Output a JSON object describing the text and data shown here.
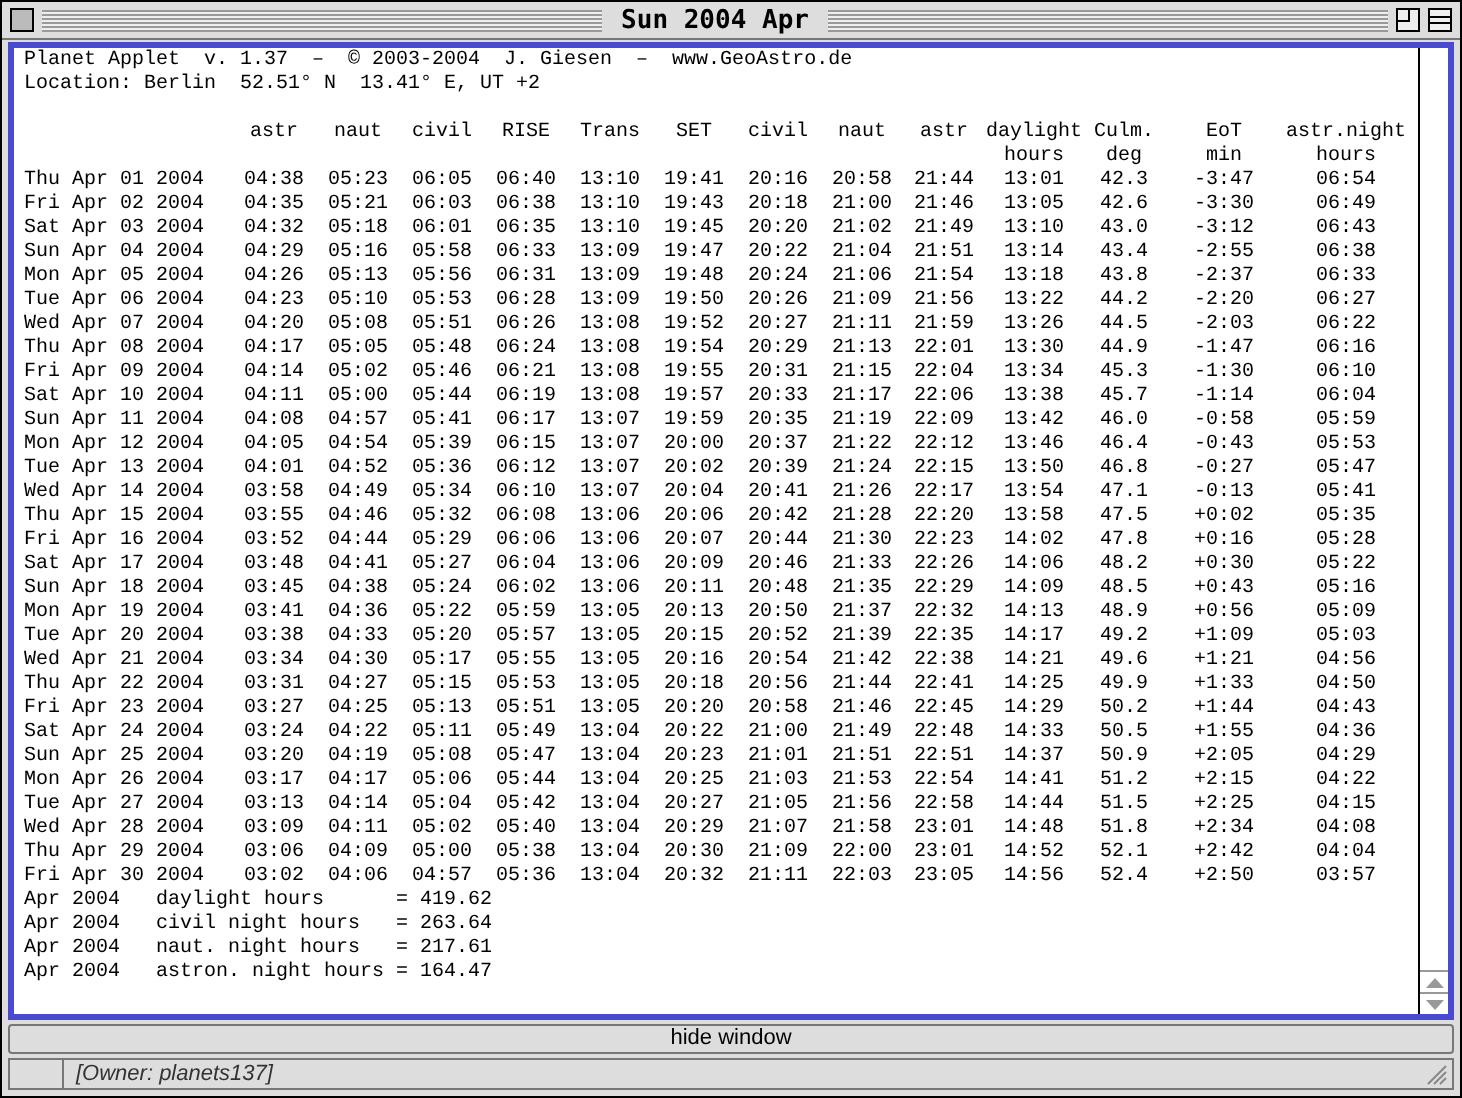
{
  "window": {
    "title": "Sun 2004 Apr"
  },
  "header_lines": [
    "Planet Applet  v. 1.37  –  © 2003-2004  J. Giesen  –  www.GeoAstro.de",
    "Location: Berlin  52.51° N  13.41° E, UT +2"
  ],
  "table": {
    "columns": [
      "astr",
      "naut",
      "civil",
      "RISE",
      "Trans",
      "SET",
      "civil",
      "naut",
      "astr",
      "daylight\nhours",
      "Culm.\ndeg",
      "EoT\nmin",
      "astr.night\nhours"
    ],
    "rows": [
      {
        "date": "Thu Apr 01 2004",
        "cells": [
          "04:38",
          "05:23",
          "06:05",
          "06:40",
          "13:10",
          "19:41",
          "20:16",
          "20:58",
          "21:44",
          "13:01",
          "42.3",
          "-3:47",
          "06:54"
        ]
      },
      {
        "date": "Fri Apr 02 2004",
        "cells": [
          "04:35",
          "05:21",
          "06:03",
          "06:38",
          "13:10",
          "19:43",
          "20:18",
          "21:00",
          "21:46",
          "13:05",
          "42.6",
          "-3:30",
          "06:49"
        ]
      },
      {
        "date": "Sat Apr 03 2004",
        "cells": [
          "04:32",
          "05:18",
          "06:01",
          "06:35",
          "13:10",
          "19:45",
          "20:20",
          "21:02",
          "21:49",
          "13:10",
          "43.0",
          "-3:12",
          "06:43"
        ]
      },
      {
        "date": "Sun Apr 04 2004",
        "cells": [
          "04:29",
          "05:16",
          "05:58",
          "06:33",
          "13:09",
          "19:47",
          "20:22",
          "21:04",
          "21:51",
          "13:14",
          "43.4",
          "-2:55",
          "06:38"
        ]
      },
      {
        "date": "Mon Apr 05 2004",
        "cells": [
          "04:26",
          "05:13",
          "05:56",
          "06:31",
          "13:09",
          "19:48",
          "20:24",
          "21:06",
          "21:54",
          "13:18",
          "43.8",
          "-2:37",
          "06:33"
        ]
      },
      {
        "date": "Tue Apr 06 2004",
        "cells": [
          "04:23",
          "05:10",
          "05:53",
          "06:28",
          "13:09",
          "19:50",
          "20:26",
          "21:09",
          "21:56",
          "13:22",
          "44.2",
          "-2:20",
          "06:27"
        ]
      },
      {
        "date": "Wed Apr 07 2004",
        "cells": [
          "04:20",
          "05:08",
          "05:51",
          "06:26",
          "13:08",
          "19:52",
          "20:27",
          "21:11",
          "21:59",
          "13:26",
          "44.5",
          "-2:03",
          "06:22"
        ]
      },
      {
        "date": "Thu Apr 08 2004",
        "cells": [
          "04:17",
          "05:05",
          "05:48",
          "06:24",
          "13:08",
          "19:54",
          "20:29",
          "21:13",
          "22:01",
          "13:30",
          "44.9",
          "-1:47",
          "06:16"
        ]
      },
      {
        "date": "Fri Apr 09 2004",
        "cells": [
          "04:14",
          "05:02",
          "05:46",
          "06:21",
          "13:08",
          "19:55",
          "20:31",
          "21:15",
          "22:04",
          "13:34",
          "45.3",
          "-1:30",
          "06:10"
        ]
      },
      {
        "date": "Sat Apr 10 2004",
        "cells": [
          "04:11",
          "05:00",
          "05:44",
          "06:19",
          "13:08",
          "19:57",
          "20:33",
          "21:17",
          "22:06",
          "13:38",
          "45.7",
          "-1:14",
          "06:04"
        ]
      },
      {
        "date": "Sun Apr 11 2004",
        "cells": [
          "04:08",
          "04:57",
          "05:41",
          "06:17",
          "13:07",
          "19:59",
          "20:35",
          "21:19",
          "22:09",
          "13:42",
          "46.0",
          "-0:58",
          "05:59"
        ]
      },
      {
        "date": "Mon Apr 12 2004",
        "cells": [
          "04:05",
          "04:54",
          "05:39",
          "06:15",
          "13:07",
          "20:00",
          "20:37",
          "21:22",
          "22:12",
          "13:46",
          "46.4",
          "-0:43",
          "05:53"
        ]
      },
      {
        "date": "Tue Apr 13 2004",
        "cells": [
          "04:01",
          "04:52",
          "05:36",
          "06:12",
          "13:07",
          "20:02",
          "20:39",
          "21:24",
          "22:15",
          "13:50",
          "46.8",
          "-0:27",
          "05:47"
        ]
      },
      {
        "date": "Wed Apr 14 2004",
        "cells": [
          "03:58",
          "04:49",
          "05:34",
          "06:10",
          "13:07",
          "20:04",
          "20:41",
          "21:26",
          "22:17",
          "13:54",
          "47.1",
          "-0:13",
          "05:41"
        ]
      },
      {
        "date": "Thu Apr 15 2004",
        "cells": [
          "03:55",
          "04:46",
          "05:32",
          "06:08",
          "13:06",
          "20:06",
          "20:42",
          "21:28",
          "22:20",
          "13:58",
          "47.5",
          "+0:02",
          "05:35"
        ]
      },
      {
        "date": "Fri Apr 16 2004",
        "cells": [
          "03:52",
          "04:44",
          "05:29",
          "06:06",
          "13:06",
          "20:07",
          "20:44",
          "21:30",
          "22:23",
          "14:02",
          "47.8",
          "+0:16",
          "05:28"
        ]
      },
      {
        "date": "Sat Apr 17 2004",
        "cells": [
          "03:48",
          "04:41",
          "05:27",
          "06:04",
          "13:06",
          "20:09",
          "20:46",
          "21:33",
          "22:26",
          "14:06",
          "48.2",
          "+0:30",
          "05:22"
        ]
      },
      {
        "date": "Sun Apr 18 2004",
        "cells": [
          "03:45",
          "04:38",
          "05:24",
          "06:02",
          "13:06",
          "20:11",
          "20:48",
          "21:35",
          "22:29",
          "14:09",
          "48.5",
          "+0:43",
          "05:16"
        ]
      },
      {
        "date": "Mon Apr 19 2004",
        "cells": [
          "03:41",
          "04:36",
          "05:22",
          "05:59",
          "13:05",
          "20:13",
          "20:50",
          "21:37",
          "22:32",
          "14:13",
          "48.9",
          "+0:56",
          "05:09"
        ]
      },
      {
        "date": "Tue Apr 20 2004",
        "cells": [
          "03:38",
          "04:33",
          "05:20",
          "05:57",
          "13:05",
          "20:15",
          "20:52",
          "21:39",
          "22:35",
          "14:17",
          "49.2",
          "+1:09",
          "05:03"
        ]
      },
      {
        "date": "Wed Apr 21 2004",
        "cells": [
          "03:34",
          "04:30",
          "05:17",
          "05:55",
          "13:05",
          "20:16",
          "20:54",
          "21:42",
          "22:38",
          "14:21",
          "49.6",
          "+1:21",
          "04:56"
        ]
      },
      {
        "date": "Thu Apr 22 2004",
        "cells": [
          "03:31",
          "04:27",
          "05:15",
          "05:53",
          "13:05",
          "20:18",
          "20:56",
          "21:44",
          "22:41",
          "14:25",
          "49.9",
          "+1:33",
          "04:50"
        ]
      },
      {
        "date": "Fri Apr 23 2004",
        "cells": [
          "03:27",
          "04:25",
          "05:13",
          "05:51",
          "13:05",
          "20:20",
          "20:58",
          "21:46",
          "22:45",
          "14:29",
          "50.2",
          "+1:44",
          "04:43"
        ]
      },
      {
        "date": "Sat Apr 24 2004",
        "cells": [
          "03:24",
          "04:22",
          "05:11",
          "05:49",
          "13:04",
          "20:22",
          "21:00",
          "21:49",
          "22:48",
          "14:33",
          "50.5",
          "+1:55",
          "04:36"
        ]
      },
      {
        "date": "Sun Apr 25 2004",
        "cells": [
          "03:20",
          "04:19",
          "05:08",
          "05:47",
          "13:04",
          "20:23",
          "21:01",
          "21:51",
          "22:51",
          "14:37",
          "50.9",
          "+2:05",
          "04:29"
        ]
      },
      {
        "date": "Mon Apr 26 2004",
        "cells": [
          "03:17",
          "04:17",
          "05:06",
          "05:44",
          "13:04",
          "20:25",
          "21:03",
          "21:53",
          "22:54",
          "14:41",
          "51.2",
          "+2:15",
          "04:22"
        ]
      },
      {
        "date": "Tue Apr 27 2004",
        "cells": [
          "03:13",
          "04:14",
          "05:04",
          "05:42",
          "13:04",
          "20:27",
          "21:05",
          "21:56",
          "22:58",
          "14:44",
          "51.5",
          "+2:25",
          "04:15"
        ]
      },
      {
        "date": "Wed Apr 28 2004",
        "cells": [
          "03:09",
          "04:11",
          "05:02",
          "05:40",
          "13:04",
          "20:29",
          "21:07",
          "21:58",
          "23:01",
          "14:48",
          "51.8",
          "+2:34",
          "04:08"
        ]
      },
      {
        "date": "Thu Apr 29 2004",
        "cells": [
          "03:06",
          "04:09",
          "05:00",
          "05:38",
          "13:04",
          "20:30",
          "21:09",
          "22:00",
          "23:01",
          "14:52",
          "52.1",
          "+2:42",
          "04:04"
        ]
      },
      {
        "date": "Fri Apr 30 2004",
        "cells": [
          "03:02",
          "04:06",
          "04:57",
          "05:36",
          "13:04",
          "20:32",
          "21:11",
          "22:03",
          "23:05",
          "14:56",
          "52.4",
          "+2:50",
          "03:57"
        ]
      }
    ]
  },
  "summary": [
    {
      "period": "Apr 2004",
      "label": "daylight hours",
      "value": "= 419.62"
    },
    {
      "period": "Apr 2004",
      "label": "civil night hours",
      "value": "= 263.64"
    },
    {
      "period": "Apr 2004",
      "label": "naut. night hours",
      "value": "= 217.61"
    },
    {
      "period": "Apr 2004",
      "label": "astron. night hours",
      "value": "= 164.47"
    }
  ],
  "button": "hide window",
  "status_bar": "[Owner: planets137]"
}
